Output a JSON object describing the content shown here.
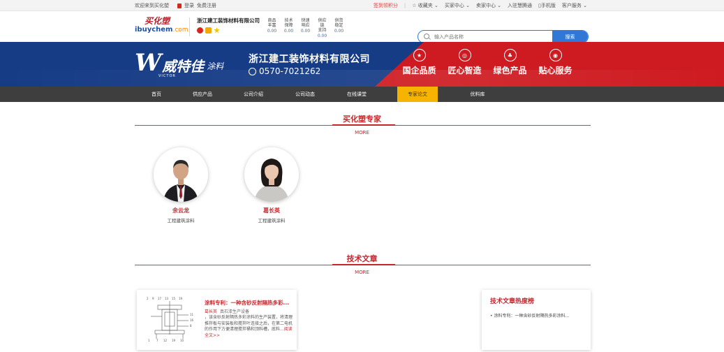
{
  "topbar": {
    "welcome": "欢迎来到买化塑",
    "login": "登录",
    "register": "免费注册",
    "sign_in": "签到领积分",
    "favorites": "收藏夹",
    "buyer_center": "买家中心",
    "seller_center": "卖家中心",
    "join": "入驻慧腾通",
    "mobile": "手机版",
    "service": "客户服务"
  },
  "logo": {
    "cn": "买化塑",
    "en_main": "ibuychem",
    "en_suffix": ".com"
  },
  "company": {
    "name": "浙江建工装饰材料有限公司"
  },
  "stats": [
    {
      "l1": "商品",
      "l2": "丰富",
      "value": "0.00"
    },
    {
      "l1": "技术",
      "l2": "保障",
      "value": "0.00"
    },
    {
      "l1": "快速",
      "l2": "响应",
      "value": "0.00"
    },
    {
      "l1": "供应链",
      "l2": "支持",
      "value": "0.00"
    },
    {
      "l1": "供货",
      "l2": "稳定",
      "value": "0.00"
    }
  ],
  "search": {
    "placeholder": "输入产品名称",
    "button": "搜索"
  },
  "banner": {
    "logo_char": "W",
    "logo_text": "威特佳",
    "logo_en": "VICTOR",
    "logo_tail": "涂料",
    "company_name": "浙江建工装饰材料有限公司",
    "phone": "0570-7021262",
    "features": [
      "国企品质",
      "匠心智造",
      "绿色产品",
      "贴心服务"
    ]
  },
  "nav": [
    "首页",
    "供应产品",
    "公司介绍",
    "公司动态",
    "在线课堂",
    "专家论文",
    "优料库"
  ],
  "experts_section": {
    "title": "买化塑专家",
    "more": "MORE"
  },
  "experts": [
    {
      "name": "余云龙",
      "title": "工程建筑涂料"
    },
    {
      "name": "葛长英",
      "title": "工程建筑涂料"
    }
  ],
  "articles_section": {
    "title": "技术文章",
    "more": "MORE"
  },
  "article": {
    "title": "涂料专利：一种含砂反射隔热多彩...",
    "author": "葛长英",
    "category": "真石漆生产设备",
    "desc": "，该含砂反射隔热多彩涂料的生产装置，将清理推拌板与安装板和搅拌叶连接之后，在第二电机的作用下方便清理搅拌桶和顶料槽，底料...",
    "readmore": "阅读全文>>"
  },
  "hot": {
    "title": "技术文章热度榜",
    "items": [
      "• 涂料专利：一种含砂反射隔热多彩涂料..."
    ]
  },
  "colors": {
    "brand_red": "#c5262b",
    "banner_blue": "#163c86",
    "banner_red": "#ce1b21",
    "nav_bg": "#3e3e3e",
    "nav_active": "#f6b400",
    "search_blue": "#2f78d6"
  }
}
